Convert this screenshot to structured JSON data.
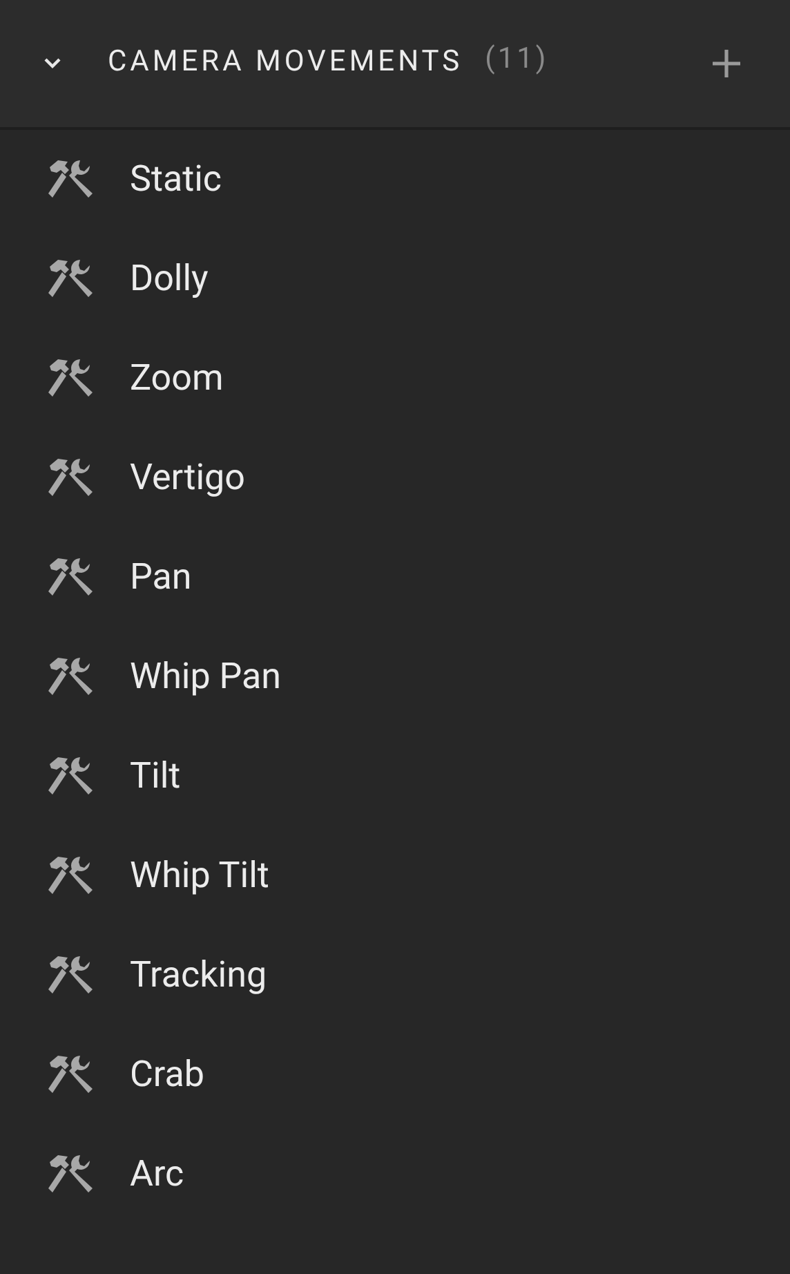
{
  "section": {
    "title": "CAMERA MOVEMENTS",
    "count": "(11)",
    "expanded": true
  },
  "items": [
    {
      "label": "Static"
    },
    {
      "label": "Dolly"
    },
    {
      "label": "Zoom"
    },
    {
      "label": "Vertigo"
    },
    {
      "label": "Pan"
    },
    {
      "label": "Whip Pan"
    },
    {
      "label": "Tilt"
    },
    {
      "label": "Whip Tilt"
    },
    {
      "label": "Tracking"
    },
    {
      "label": "Crab"
    },
    {
      "label": "Arc"
    }
  ]
}
